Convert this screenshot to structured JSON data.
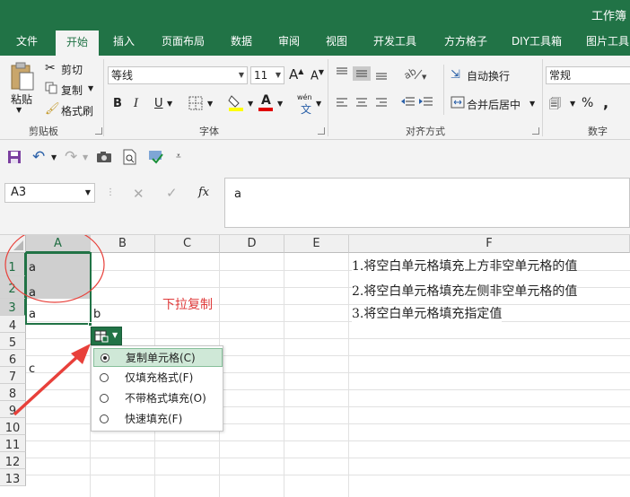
{
  "window": {
    "title": "工作簿"
  },
  "tabs": [
    {
      "label": "文件",
      "active": false
    },
    {
      "label": "开始",
      "active": true
    },
    {
      "label": "插入",
      "active": false
    },
    {
      "label": "页面布局",
      "active": false
    },
    {
      "label": "数据",
      "active": false
    },
    {
      "label": "审阅",
      "active": false
    },
    {
      "label": "视图",
      "active": false
    },
    {
      "label": "开发工具",
      "active": false
    },
    {
      "label": "方方格子",
      "active": false
    },
    {
      "label": "DIY工具箱",
      "active": false
    },
    {
      "label": "图片工具",
      "active": false
    }
  ],
  "ribbon": {
    "clipboard": {
      "paste": "粘贴",
      "cut": "剪切",
      "copy": "复制",
      "format_painter": "格式刷",
      "label": "剪贴板"
    },
    "font": {
      "name": "等线",
      "size": "11",
      "grow": "A",
      "shrink": "A",
      "bold": "B",
      "italic": "I",
      "underline": "U",
      "font_color": "A",
      "phonetic": "wén",
      "phonetic2": "文",
      "label": "字体"
    },
    "alignment": {
      "wrap": "自动换行",
      "merge": "合并后居中",
      "label": "对齐方式"
    },
    "number": {
      "format": "常规",
      "percent": "%",
      "label": "数字"
    }
  },
  "formula_bar": {
    "name_box": "A3",
    "fx": "fx",
    "value": "a"
  },
  "columns": [
    "A",
    "B",
    "C",
    "D",
    "E",
    "F"
  ],
  "rows": [
    "1",
    "2",
    "3",
    "4",
    "5",
    "6",
    "7",
    "8",
    "9",
    "10",
    "11",
    "12",
    "13"
  ],
  "cells": {
    "A1": "a",
    "A2": "a",
    "A3": "a",
    "B3": "b",
    "A6": "c",
    "F1": "1.将空白单元格填充上方非空单元格的值",
    "F2": "2.将空白单元格填充左侧非空单元格的值",
    "F3": "3.将空白单元格填充指定值"
  },
  "annotation": "下拉复制",
  "autofill_menu": {
    "items": [
      {
        "label": "复制单元格(C)",
        "selected": true
      },
      {
        "label": "仅填充格式(F)",
        "selected": false
      },
      {
        "label": "不带格式填充(O)",
        "selected": false
      },
      {
        "label": "快速填充(F)",
        "selected": false
      }
    ]
  },
  "colors": {
    "excel_green": "#217346",
    "selection_fill": "#cfcfcf",
    "annotation_red": "#e03c3c",
    "arrow_red": "#e8403a"
  }
}
